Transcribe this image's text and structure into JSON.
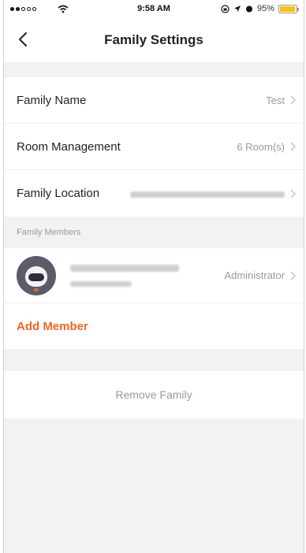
{
  "status_bar": {
    "carrier_signal": "●●○○○",
    "time": "9:58 AM",
    "battery_percent": "95%",
    "battery_level": 0.95,
    "battery_color": "#f4c20d"
  },
  "nav": {
    "title": "Family Settings",
    "back_icon": "chevron-left-icon"
  },
  "settings": {
    "family_name": {
      "label": "Family Name",
      "value": "Test"
    },
    "room_management": {
      "label": "Room Management",
      "value": "6 Room(s)"
    },
    "family_location": {
      "label": "Family Location",
      "value": ""
    }
  },
  "members": {
    "section_header": "Family Members",
    "items": [
      {
        "role": "Administrator",
        "avatar_icon": "astronaut-avatar-icon"
      }
    ],
    "add_label": "Add Member",
    "accent_color": "#f26522"
  },
  "actions": {
    "remove_label": "Remove Family"
  }
}
